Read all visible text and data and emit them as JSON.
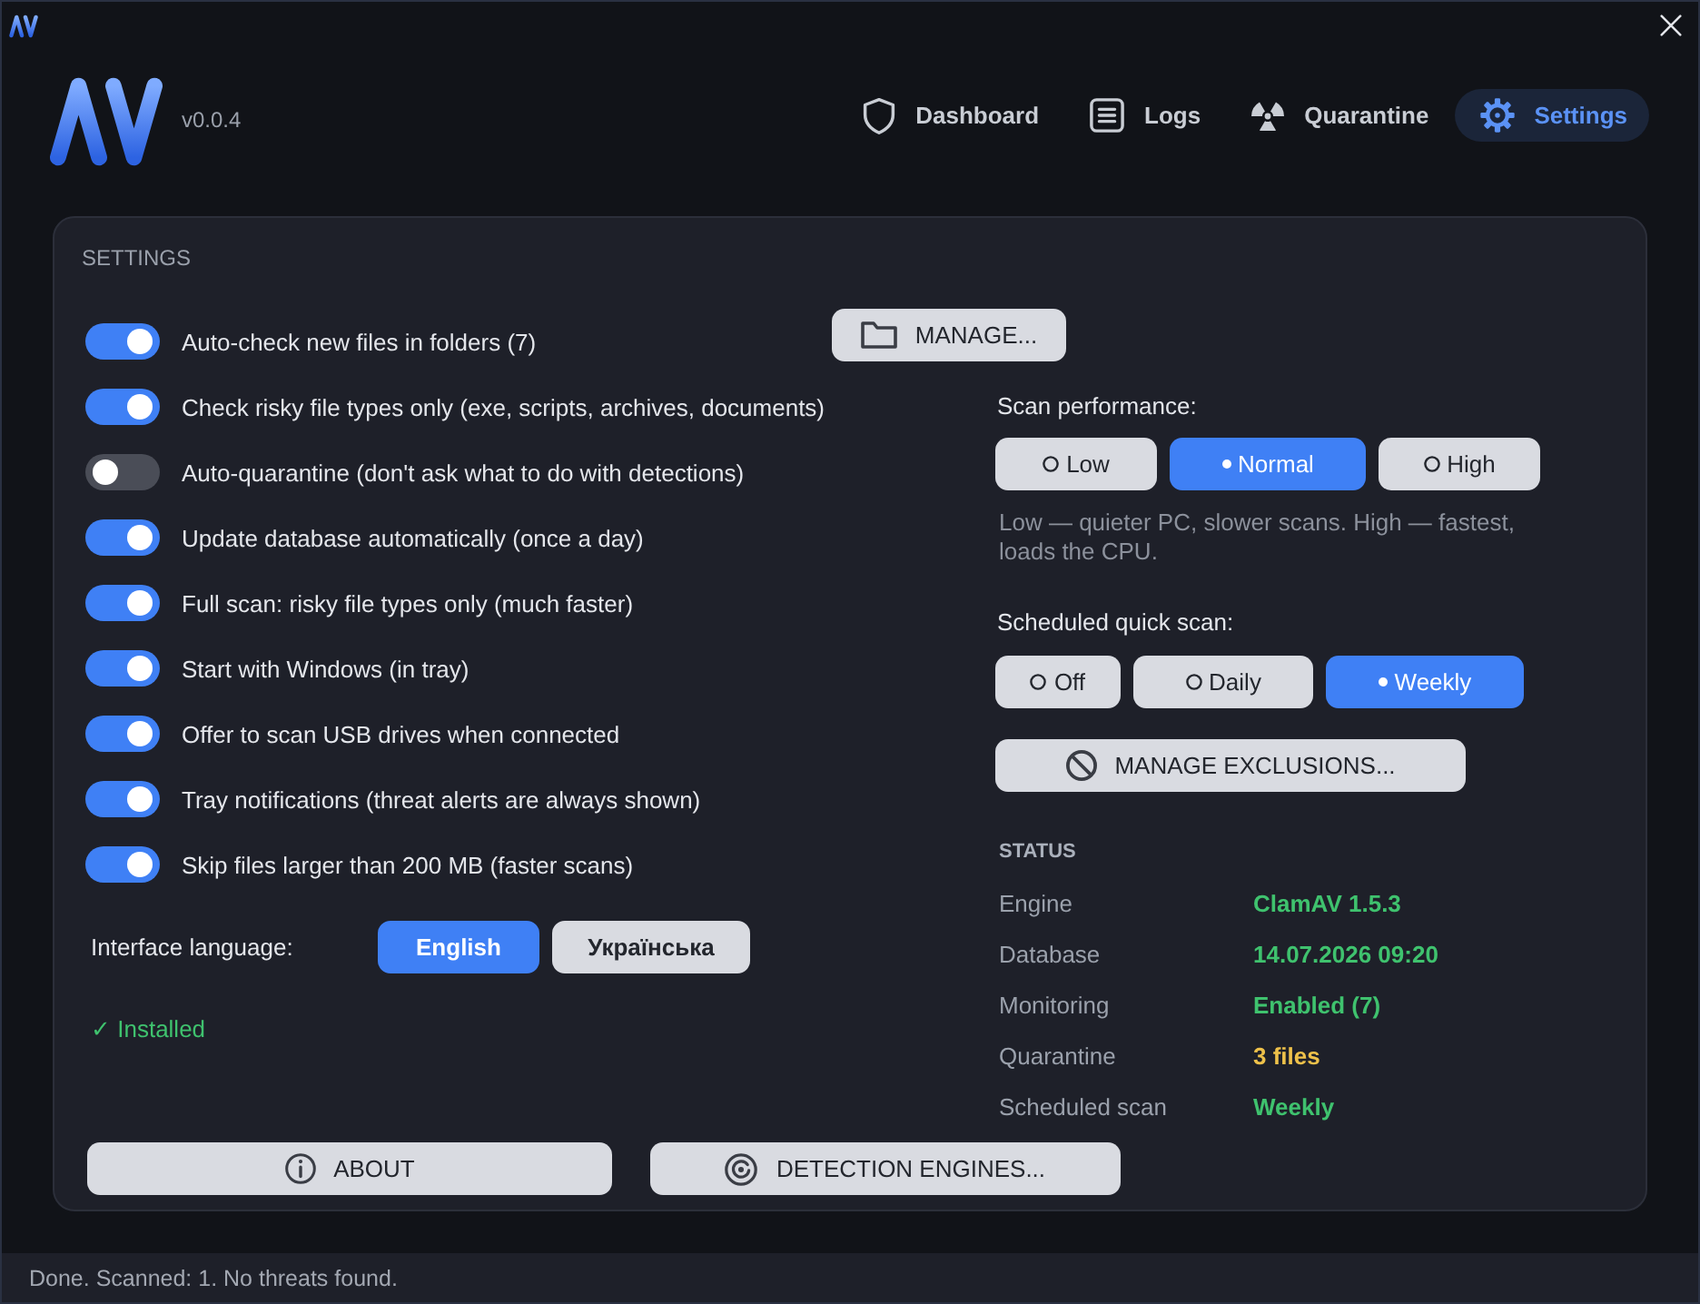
{
  "header": {
    "version": "v0.0.4",
    "nav": [
      {
        "label": "Dashboard",
        "selected": false
      },
      {
        "label": "Logs",
        "selected": false
      },
      {
        "label": "Quarantine",
        "selected": false
      },
      {
        "label": "Settings",
        "selected": true
      }
    ]
  },
  "settings": {
    "title": "SETTINGS",
    "toggles": [
      {
        "label": "Auto-check new files in folders (7)",
        "on": true
      },
      {
        "label": "Check risky file types only (exe, scripts, archives, documents)",
        "on": true
      },
      {
        "label": "Auto-quarantine (don't ask what to do with detections)",
        "on": false
      },
      {
        "label": "Update database automatically (once a day)",
        "on": true
      },
      {
        "label": "Full scan: risky file types only (much faster)",
        "on": true
      },
      {
        "label": "Start with Windows (in tray)",
        "on": true
      },
      {
        "label": "Offer to scan USB drives when connected",
        "on": true
      },
      {
        "label": "Tray notifications (threat alerts are always shown)",
        "on": true
      },
      {
        "label": "Skip files larger than 200 MB (faster scans)",
        "on": true
      }
    ],
    "manage_button": "MANAGE...",
    "language": {
      "label": "Interface language:",
      "options": [
        {
          "label": "English",
          "selected": true
        },
        {
          "label": "Українська",
          "selected": false
        }
      ]
    },
    "install_status": "✓ Installed",
    "scan_performance": {
      "label": "Scan performance:",
      "options": [
        {
          "label": "Low",
          "selected": false
        },
        {
          "label": "Normal",
          "selected": true
        },
        {
          "label": "High",
          "selected": false
        }
      ],
      "hint": "Low — quieter PC, slower scans. High — fastest, loads the CPU."
    },
    "scheduled_scan": {
      "label": "Scheduled quick scan:",
      "options": [
        {
          "label": "Off",
          "selected": false
        },
        {
          "label": "Daily",
          "selected": false
        },
        {
          "label": "Weekly",
          "selected": true
        }
      ]
    },
    "exclusions_button": "MANAGE EXCLUSIONS...",
    "status": {
      "title": "STATUS",
      "rows": [
        {
          "label": "Engine",
          "value": "ClamAV 1.5.3",
          "color": "#3fc26e"
        },
        {
          "label": "Database",
          "value": "14.07.2026 09:20",
          "color": "#3fc26e"
        },
        {
          "label": "Monitoring",
          "value": "Enabled (7)",
          "color": "#3fc26e"
        },
        {
          "label": "Quarantine",
          "value": "3 files",
          "color": "#eec14a"
        },
        {
          "label": "Scheduled scan",
          "value": "Weekly",
          "color": "#3fc26e"
        }
      ]
    },
    "buttons": [
      "ABOUT",
      "DETECTION ENGINES..."
    ]
  },
  "status_bar": "Done. Scanned: 1. No threats found."
}
